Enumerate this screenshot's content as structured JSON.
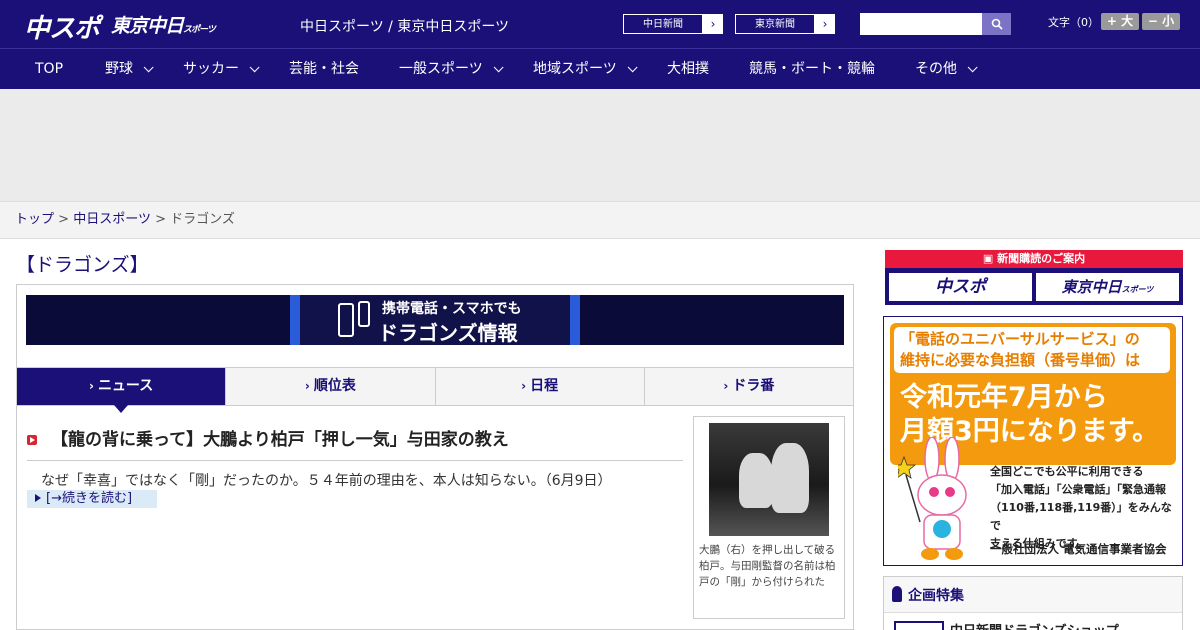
{
  "header": {
    "logo_main": "中スポ",
    "logo_sub": "東京中日",
    "logo_sub_small": "スポーツ",
    "site_links": "中日スポーツ / 東京中日スポーツ",
    "btn_chunichi": "中日新聞",
    "btn_tokyo": "東京新聞",
    "search_placeholder": "",
    "font_size_label": "文字（0）",
    "font_plus": "+ 大",
    "font_minus": "− 小"
  },
  "nav": {
    "items": [
      "TOP",
      "野球",
      "サッカー",
      "芸能・社会",
      "一般スポーツ",
      "地域スポーツ",
      "大相撲",
      "競馬・ボート・競輪",
      "その他"
    ]
  },
  "breadcrumb": {
    "top": "トップ",
    "chunichi": "中日スポーツ",
    "current": "ドラゴンズ",
    "sep": ">"
  },
  "page": {
    "title": "【ドラゴンズ】"
  },
  "promo": {
    "line1": "携帯電話・スマホでも",
    "line2": "ドラゴンズ情報"
  },
  "tabs": [
    "ニュース",
    "順位表",
    "日程",
    "ドラ番"
  ],
  "article": {
    "title": "【龍の背に乗って】大鵬より柏戸「押し一気」与田家の教え",
    "summary": "なぜ「幸喜」ではなく「剛」だったのか。５４年前の理由を、本人は知らない。（6月9日）",
    "read_more": "[→続きを読む]",
    "photo_caption": "大鵬（右）を押し出して破る柏戸。与田剛監督の名前は柏戸の「剛」から付けられた"
  },
  "sidebar": {
    "subscribe_header": "新聞購読のご案内",
    "subscribe_btn1": "中スポ",
    "subscribe_btn2": "東京中日",
    "subscribe_btn2_small": "スポーツ",
    "ad_box_line1": "「電話のユニバーサルサービス」の",
    "ad_box_line2": "維持に必要な負担額（番号単価）は",
    "ad_big1": "令和元年7月から",
    "ad_big2": "月額3円になります。",
    "ad_small1": "全国どこでも公平に利用できる",
    "ad_small2": "「加入電話」「公衆電話」「緊急通報",
    "ad_small3": "（110番,118番,119番）」をみんなで",
    "ad_small4": "支える仕組みです。",
    "ad_foot": "一般社団法人 電気通信事業者協会",
    "feature_title": "企画特集",
    "feature_item": "中日新聞ドラゴンズショップ"
  }
}
